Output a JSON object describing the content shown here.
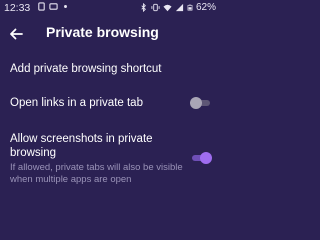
{
  "status_bar": {
    "time": "12:33",
    "battery": "62%",
    "icons_left": [
      "sim-icon",
      "notification-icon",
      "dot-icon"
    ],
    "icons_right": [
      "bluetooth-icon",
      "vibrate-icon",
      "wifi-icon",
      "signal-icon",
      "battery-icon"
    ]
  },
  "app_bar": {
    "title": "Private browsing",
    "back_icon": "arrow-left-icon"
  },
  "settings": {
    "add_shortcut": {
      "title": "Add private browsing shortcut"
    },
    "open_links": {
      "title": "Open links in a private tab",
      "enabled": false
    },
    "allow_screenshots": {
      "title": "Allow screenshots in private browsing",
      "summary": "If allowed, private tabs will also be visible when multiple apps are open",
      "enabled": true
    }
  },
  "colors": {
    "background": "#2b2153",
    "accent": "#9f6df0",
    "secondary_text": "#9a93b8"
  }
}
